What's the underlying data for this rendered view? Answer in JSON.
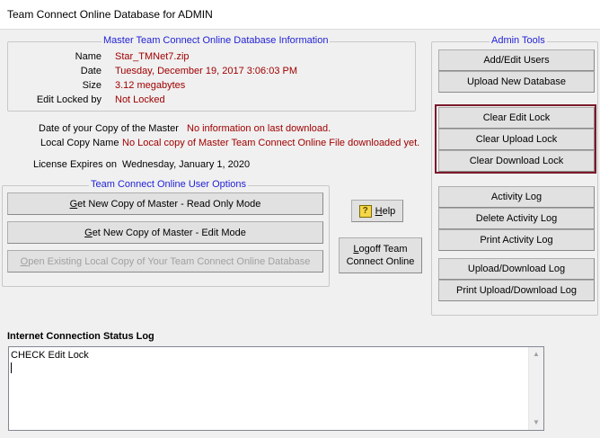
{
  "window": {
    "title": "Team Connect Online Database for ADMIN"
  },
  "master_info": {
    "legend": "Master Team Connect Online Database Information",
    "rows": [
      {
        "label": "Name",
        "value": "Star_TMNet7.zip"
      },
      {
        "label": "Date",
        "value": "Tuesday, December 19, 2017 3:06:03 PM"
      },
      {
        "label": "Size",
        "value": "3.12 megabytes"
      },
      {
        "label": "Edit Locked by",
        "value": "Not Locked"
      }
    ]
  },
  "copy_info": {
    "date_label": "Date of your Copy of the  Master",
    "date_value": "No information on last download.",
    "local_label": "Local Copy Name",
    "local_value": "No Local copy of Master Team Connect Online File downloaded yet.",
    "license_label": "License Expires on",
    "license_value": "Wednesday, January 1, 2020"
  },
  "user_options": {
    "legend": "Team Connect Online User Options",
    "read_only": {
      "hot": "G",
      "rest": "et New Copy of Master - Read Only Mode"
    },
    "edit_mode": {
      "hot": "G",
      "rest": "et New Copy of Master - Edit Mode"
    },
    "open_local": {
      "hot": "O",
      "rest": "pen Existing Local Copy of Your Team Connect Online Database"
    }
  },
  "help": {
    "hot": "H",
    "rest": "elp",
    "icon": "help-icon"
  },
  "logoff": {
    "hot": "L",
    "rest": "ogoff Team",
    "line2": "Connect Online"
  },
  "admin_tools": {
    "legend": "Admin Tools",
    "add_edit_users": "Add/Edit Users",
    "upload_new_db": "Upload New Database",
    "clear_edit_lock": "Clear Edit Lock",
    "clear_upload_lock": "Clear Upload Lock",
    "clear_download_lock": "Clear Download Lock",
    "activity_log": "Activity Log",
    "delete_activity_log": "Delete Activity Log",
    "print_activity_log": "Print Activity Log",
    "upload_download_log": "Upload/Download Log",
    "print_upload_download_log": "Print Upload/Download Log"
  },
  "status_log": {
    "title": "Internet Connection Status Log",
    "content": "CHECK Edit Lock"
  },
  "colors": {
    "value_red": "#a00000",
    "legend_blue": "#1f1fd6",
    "highlight": "#7a1a2a"
  }
}
